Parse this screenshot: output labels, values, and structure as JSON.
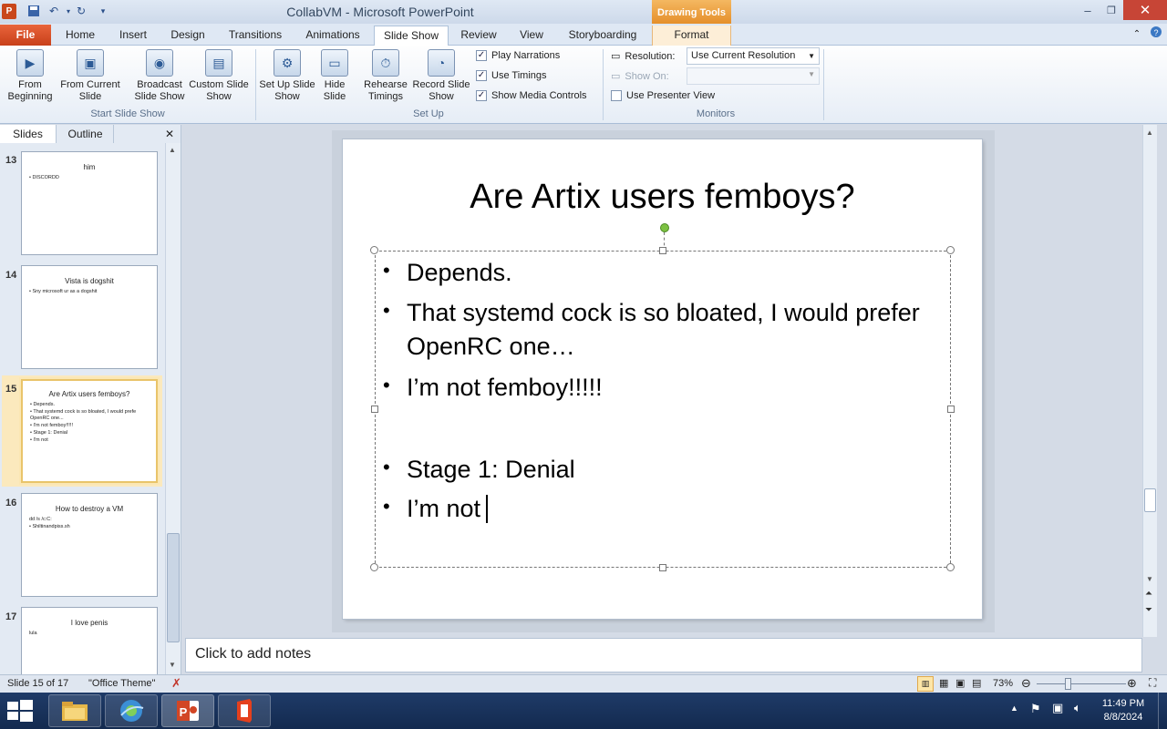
{
  "window": {
    "title": "CollabVM - Microsoft PowerPoint",
    "context_group": "Drawing Tools",
    "close": "✕",
    "minimize": "–",
    "restore": "❐"
  },
  "tabs": [
    {
      "label": "File"
    },
    {
      "label": "Home"
    },
    {
      "label": "Insert"
    },
    {
      "label": "Design"
    },
    {
      "label": "Transitions"
    },
    {
      "label": "Animations"
    },
    {
      "label": "Slide Show"
    },
    {
      "label": "Review"
    },
    {
      "label": "View"
    },
    {
      "label": "Storyboarding"
    },
    {
      "label": "Format"
    }
  ],
  "ribbon": {
    "start": {
      "from_beginning": "From Beginning",
      "from_current": "From Current Slide",
      "broadcast": "Broadcast Slide Show",
      "custom": "Custom Slide Show",
      "group_label": "Start Slide Show"
    },
    "setup": {
      "setup_show": "Set Up Slide Show",
      "hide_slide": "Hide Slide",
      "rehearse": "Rehearse Timings",
      "record": "Record Slide Show",
      "play_narrations": "Play Narrations",
      "use_timings": "Use Timings",
      "show_media": "Show Media Controls",
      "group_label": "Set Up",
      "checked": "✓"
    },
    "monitors": {
      "resolution_label": "Resolution:",
      "resolution_value": "Use Current Resolution",
      "show_on": "Show On:",
      "presenter_view": "Use Presenter View",
      "group_label": "Monitors"
    }
  },
  "panel": {
    "tab_slides": "Slides",
    "tab_outline": "Outline",
    "close": "✕",
    "thumbs": [
      {
        "num": "13",
        "title": "him",
        "lines": [
          "• DISCORDD"
        ]
      },
      {
        "num": "14",
        "title": "Vista is dogshit",
        "lines": [
          "• Sny microsoft ur as a dogshit"
        ]
      },
      {
        "num": "15",
        "title": "Are Artix users femboys?",
        "lines": [
          "• Depends.",
          "• That systemd cock is so bloated, I would prefe OpenRC one...",
          "• I'm not femboy!!!!!",
          " ",
          "• Stage 1: Denial",
          "• I'm not"
        ]
      },
      {
        "num": "16",
        "title": "How to destroy a VM",
        "lines": [
          "dd /s /c:C:",
          "• Shiltinandpiss.sh"
        ]
      },
      {
        "num": "17",
        "title": "I love penis",
        "lines": [
          "lula"
        ]
      }
    ]
  },
  "slide": {
    "title": "Are Artix users femboys?",
    "bullets": [
      "Depends.",
      "That systemd cock is so bloated, I would prefer",
      "OpenRC one…",
      "I’m not femboy!!!!!",
      "Stage 1: Denial",
      "I’m not"
    ],
    "bullet_char": "•"
  },
  "notes": {
    "placeholder": "Click to add notes"
  },
  "status": {
    "slide_info": "Slide 15 of 17",
    "theme": "\"Office Theme\"",
    "zoom": "73%"
  },
  "taskbar": {
    "time": "11:49 PM",
    "date": "8/8/2024"
  },
  "colors": {
    "file_tab": "#c8401a",
    "context_tab": "#e58f2a",
    "taskbar": "#1f3b68"
  }
}
